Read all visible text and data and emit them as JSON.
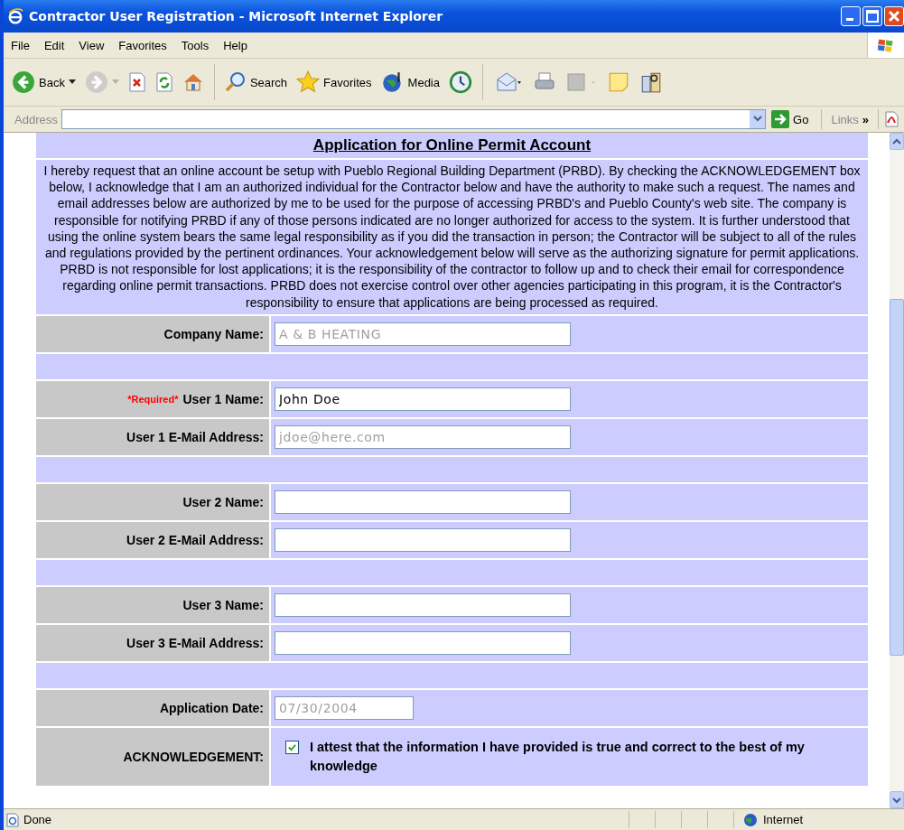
{
  "window": {
    "title": "Contractor User Registration - Microsoft Internet Explorer"
  },
  "menu": [
    "File",
    "Edit",
    "View",
    "Favorites",
    "Tools",
    "Help"
  ],
  "toolbar": [
    {
      "kind": "back",
      "label": "Back",
      "disabled": false
    },
    {
      "kind": "forward",
      "disabled": true
    },
    {
      "kind": "stop",
      "disabled": false
    },
    {
      "kind": "refresh",
      "disabled": false
    },
    {
      "kind": "home",
      "disabled": false
    },
    {
      "kind": "search",
      "label": "Search",
      "disabled": false
    },
    {
      "kind": "favorites",
      "label": "Favorites",
      "disabled": false
    },
    {
      "kind": "media",
      "label": "Media",
      "disabled": false
    },
    {
      "kind": "history",
      "disabled": false
    },
    {
      "kind": "mail",
      "disabled": false
    },
    {
      "kind": "print",
      "disabled": false
    },
    {
      "kind": "edit",
      "disabled": true
    },
    {
      "kind": "discuss",
      "disabled": false
    },
    {
      "kind": "research",
      "disabled": false
    }
  ],
  "address_bar": {
    "label": "Address",
    "go": "Go",
    "links": "Links",
    "more": "»"
  },
  "page": {
    "heading": "Application for Online Permit Account",
    "intro": "I hereby request that an online account be setup with Pueblo Regional Building Department (PRBD). By checking the ACKNOWLEDGEMENT box below, I acknowledge that I am an authorized individual for the Contractor below and have the authority to make such a request. The names and email addresses below are authorized by me to be used for the purpose of accessing PRBD's and Pueblo County's web site. The company is responsible for notifying PRBD if any of those persons indicated are no longer authorized for access to the system. It is further understood that using the online system bears the same legal responsibility as if you did the transaction in person; the Contractor will be subject to all of the rules and regulations provided by the pertinent ordinances. Your acknowledgement below will serve as the authorizing signature for permit applications. PRBD is not responsible for lost applications; it is the responsibility of the contractor to follow up and to check their email for correspondence regarding online permit transactions. PRBD does not exercise control over other agencies participating in this program, it is the Contractor's responsibility to ensure that applications are being processed as required.",
    "rows": [
      {
        "kind": "field",
        "label": "Company Name:",
        "value": "A & B HEATING",
        "disabled": true
      },
      {
        "kind": "spacer"
      },
      {
        "kind": "field",
        "required": "*Required*",
        "label": "User 1 Name:",
        "value": "John Doe",
        "disabled": false
      },
      {
        "kind": "field",
        "label": "User 1 E-Mail Address:",
        "value": "jdoe@here.com",
        "disabled": true
      },
      {
        "kind": "spacer"
      },
      {
        "kind": "field",
        "label": "User 2 Name:"
      },
      {
        "kind": "field",
        "label": "User 2 E-Mail Address:"
      },
      {
        "kind": "spacer"
      },
      {
        "kind": "field",
        "label": "User 3 Name:"
      },
      {
        "kind": "field",
        "label": "User 3 E-Mail Address:"
      },
      {
        "kind": "spacer"
      },
      {
        "kind": "date",
        "label": "Application Date:",
        "value": "07/30/2004",
        "disabled": true
      },
      {
        "kind": "checkbox",
        "label": "ACKNOWLEDGEMENT:",
        "text": "I attest that the information I have provided is true and correct to the best of my knowledge",
        "checked": true
      }
    ]
  },
  "status_bar": {
    "text": "Done",
    "zone": "Internet"
  }
}
